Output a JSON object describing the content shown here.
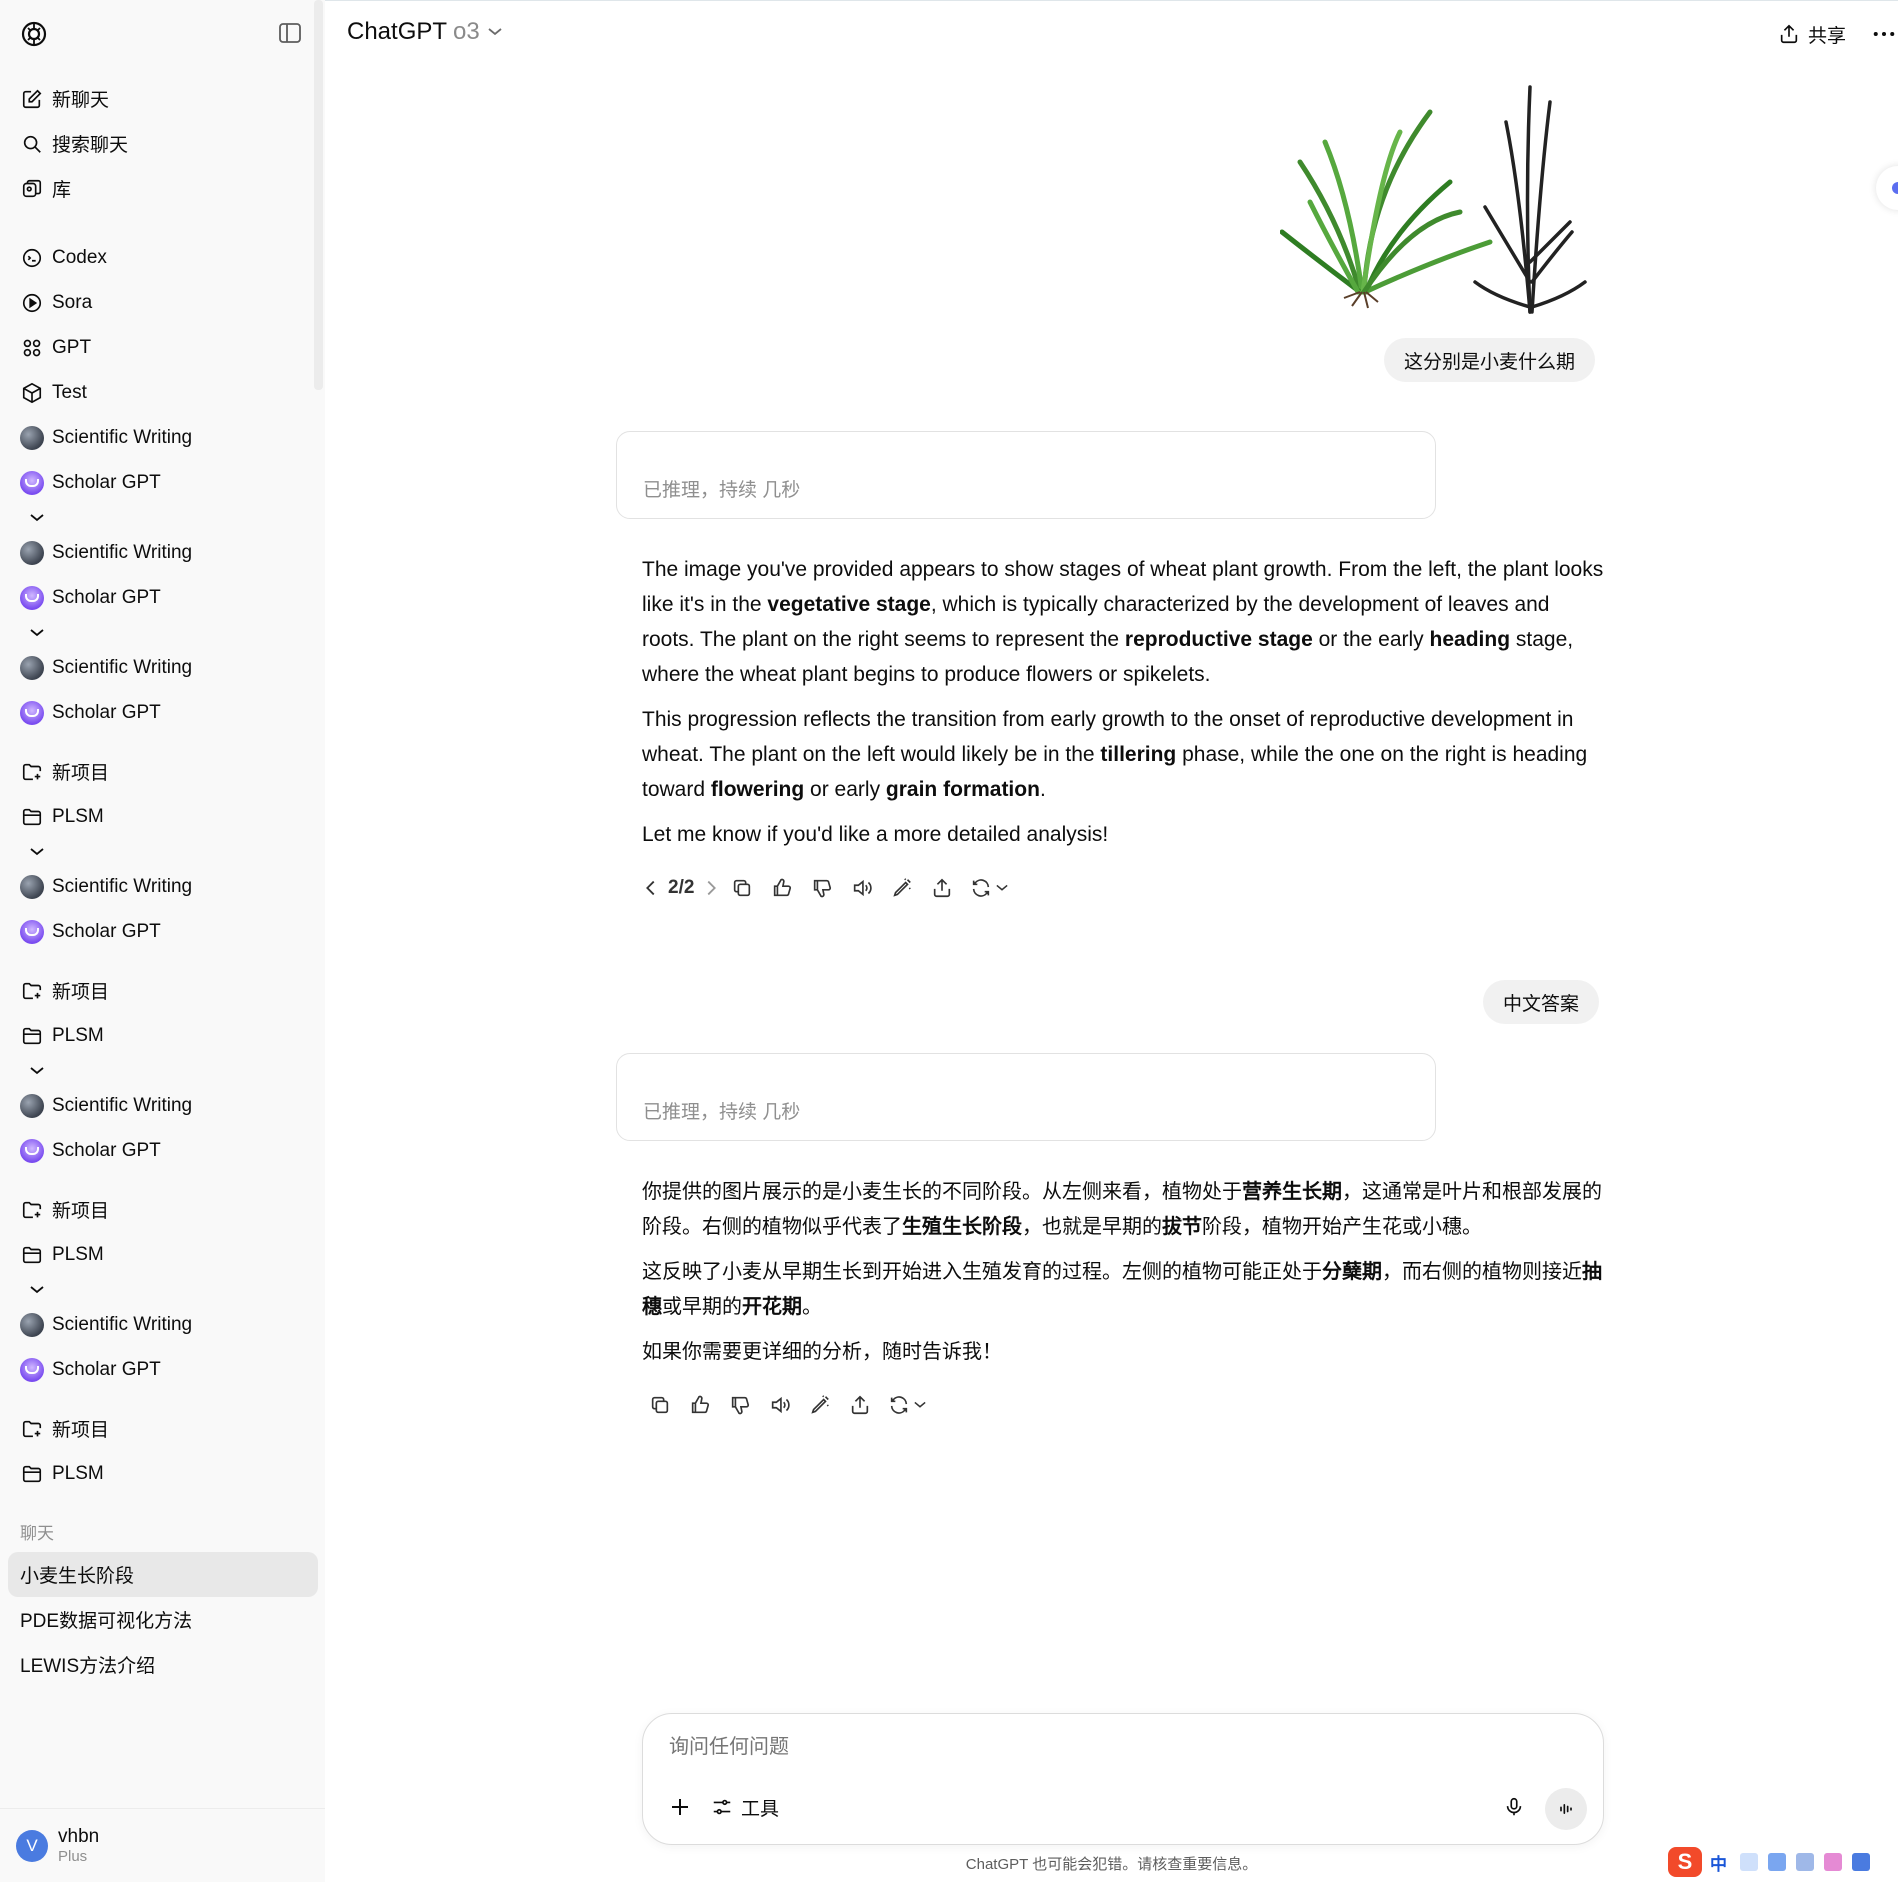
{
  "sidebar": {
    "top_items": [
      {
        "label": "新聊天",
        "icon": "edit-icon"
      },
      {
        "label": "搜索聊天",
        "icon": "search-icon"
      },
      {
        "label": "库",
        "icon": "library-icon"
      }
    ],
    "apps": [
      {
        "label": "Codex",
        "icon": "codex-icon"
      },
      {
        "label": "Sora",
        "icon": "play-circle-icon"
      },
      {
        "label": "GPT",
        "icon": "grid-icon"
      },
      {
        "label": "Test",
        "icon": "cube-icon"
      }
    ],
    "gpt_group": {
      "scientific": "Scientific Writing",
      "scholar": "Scholar GPT"
    },
    "project_group": {
      "new_project": "新项目",
      "plsm": "PLSM"
    },
    "chats_label": "聊天",
    "chats": [
      "小麦生长阶段",
      "PDE数据可视化方法",
      "LEWIS方法介绍"
    ],
    "user": {
      "initial": "V",
      "name": "vhbn",
      "plan": "Plus"
    }
  },
  "header": {
    "title": "ChatGPT",
    "model": "o3",
    "share_label": "共享"
  },
  "conversation": {
    "user_msg_1": "这分别是小麦什么期",
    "reasoning_1": "已推理，持续 几秒",
    "answer_1": {
      "p1": [
        "The image you've provided appears to show stages of wheat plant growth. From the left, the plant looks like it's in the ",
        "vegetative stage",
        ", which is typically characterized by the development of leaves and roots. The plant on the right seems to represent the ",
        "reproductive stage",
        " or the early ",
        "heading",
        " stage, where the wheat plant begins to produce flowers or spikelets."
      ],
      "p2": [
        "This progression reflects the transition from early growth to the onset of reproductive development in wheat. The plant on the left would likely be in the ",
        "tillering",
        " phase, while the one on the right is heading toward ",
        "flowering",
        " or early ",
        "grain formation",
        "."
      ],
      "p3": "Let me know if you'd like a more detailed analysis!",
      "pager": "2/2"
    },
    "user_msg_2": "中文答案",
    "reasoning_2": "已推理，持续 几秒",
    "answer_2": {
      "p1": [
        "你提供的图片展示的是小麦生长的不同阶段。从左侧来看，植物处于",
        "营养生长期",
        "，这通常是叶片和根部发展的阶段。右侧的植物似乎代表了",
        "生殖生长阶段",
        "，也就是早期的",
        "拔节",
        "阶段，植物开始产生花或小穗。"
      ],
      "p2": [
        "这反映了小麦从早期生长到开始进入生殖发育的过程。左侧的植物可能正处于",
        "分蘖期",
        "，而右侧的植物则接近",
        "抽穗",
        "或早期的",
        "开花期",
        "。"
      ],
      "p3": "如果你需要更详细的分析，随时告诉我！"
    }
  },
  "composer": {
    "placeholder": "询问任何问题",
    "tools_label": "工具"
  },
  "disclaimer": "ChatGPT 也可能会犯错。请核查重要信息。",
  "ime": {
    "lang": "中"
  },
  "colors": {
    "sidebar_bg": "#f9f9f9",
    "bubble_bg": "#f1f1f1",
    "active_chat": "#e8e8e8",
    "avatar_blue": "#4a7be0"
  }
}
